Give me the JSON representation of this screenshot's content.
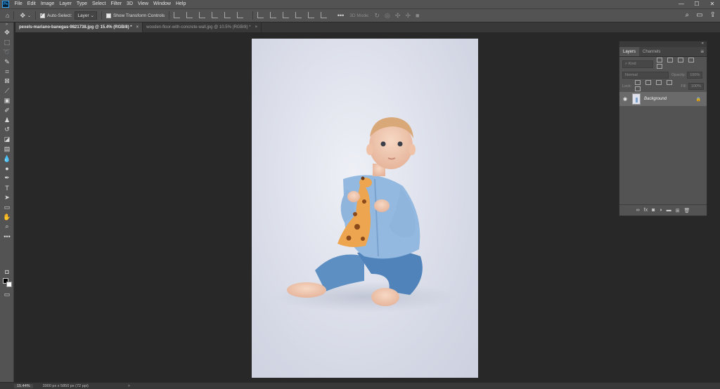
{
  "app": {
    "logo": "Ps"
  },
  "menu": [
    "File",
    "Edit",
    "Image",
    "Layer",
    "Type",
    "Select",
    "Filter",
    "3D",
    "View",
    "Window",
    "Help"
  ],
  "window_controls": {
    "minimize": "—",
    "maximize": "☐",
    "close": "✕"
  },
  "options": {
    "auto_select_label": "Auto-Select:",
    "auto_select_checked": true,
    "layer_dropdown": "Layer",
    "show_transform_label": "Show Transform Controls",
    "show_transform_checked": false,
    "mode_3d_label": "3D Mode:"
  },
  "tabs": [
    {
      "label": "pexels-mariano-banegas-9821738.jpg @ 15.4% (RGB/8) *",
      "active": true
    },
    {
      "label": "wooden-floor-with-concrete-wall.jpg @ 10.5% (RGB/8) *",
      "active": false
    }
  ],
  "tab_close": "×",
  "layers_panel": {
    "tabs": [
      "Layers",
      "Channels"
    ],
    "kind_placeholder": "Kind",
    "blend_mode": "Normal",
    "opacity_label": "Opacity:",
    "opacity_value": "100%",
    "lock_label": "Lock:",
    "fill_label": "Fill:",
    "fill_value": "100%",
    "layers": [
      {
        "name": "Background",
        "visible": true,
        "locked": true
      }
    ]
  },
  "status": {
    "zoom": "15.44%",
    "doc_size": "3900 px x 5850 px (72 ppi)",
    "arrow": ">"
  },
  "colors": {
    "accent": "#31a8ff",
    "chrome": "#535353",
    "workspace": "#282828"
  }
}
